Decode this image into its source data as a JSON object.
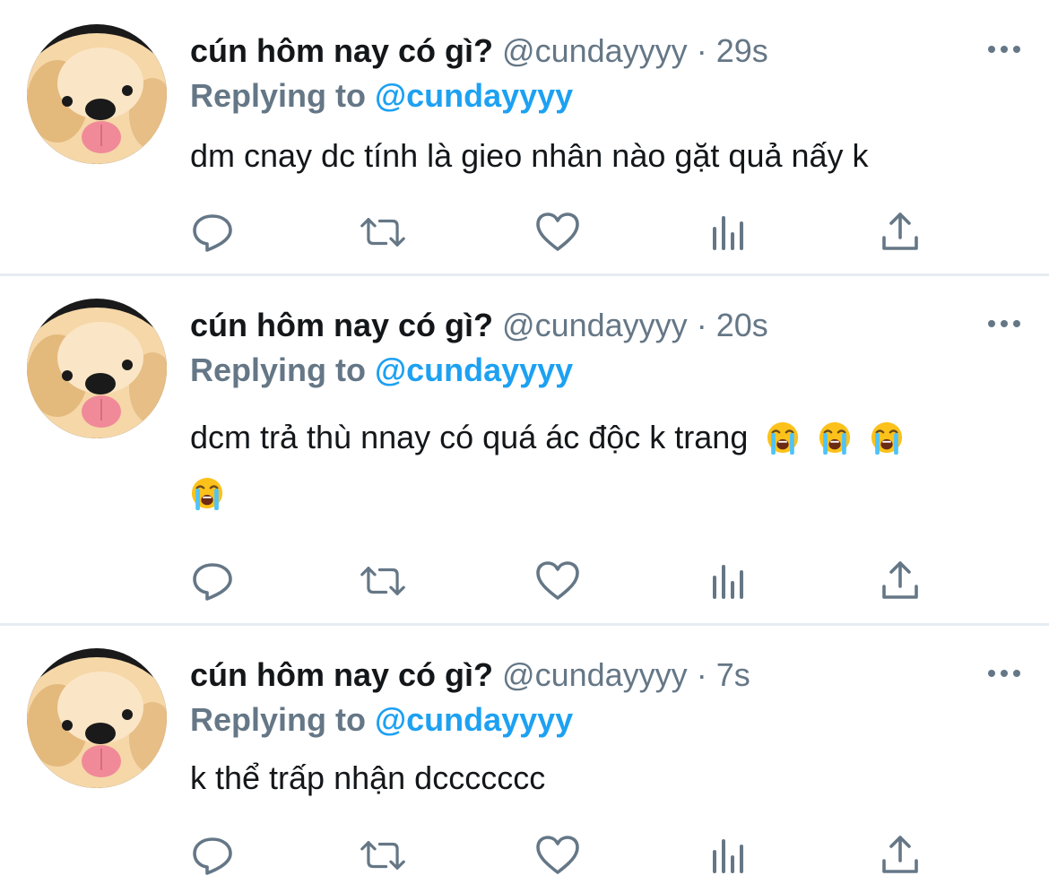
{
  "tweets": [
    {
      "name": "cún hôm nay có gì?",
      "handle": "@cundayyyy",
      "separator": "·",
      "time": "29s",
      "reply_prefix": "Replying to ",
      "reply_handle": "@cundayyyy",
      "text": "dm cnay dc tính là gieo nhân nào gặt quả nấy k"
    },
    {
      "name": "cún hôm nay có gì?",
      "handle": "@cundayyyy",
      "separator": "·",
      "time": "20s",
      "reply_prefix": "Replying to ",
      "reply_handle": "@cundayyyy",
      "text": "dcm trả thù nnay có quá ác độc k trang",
      "emoji_icon": "loudly-crying-face-emoji"
    },
    {
      "name": "cún hôm nay có gì?",
      "handle": "@cundayyyy",
      "separator": "·",
      "time": "7s",
      "reply_prefix": "Replying to ",
      "reply_handle": "@cundayyyy",
      "text": "k thể trấp nhận dccccccc"
    }
  ],
  "action_icons": [
    "reply-icon",
    "retweet-icon",
    "like-icon",
    "analytics-icon",
    "share-icon"
  ],
  "colors": {
    "text": "#14171a",
    "secondary": "#657786",
    "accent": "#1da1f2",
    "icon": "#657786",
    "divider": "#e6ecf0"
  }
}
